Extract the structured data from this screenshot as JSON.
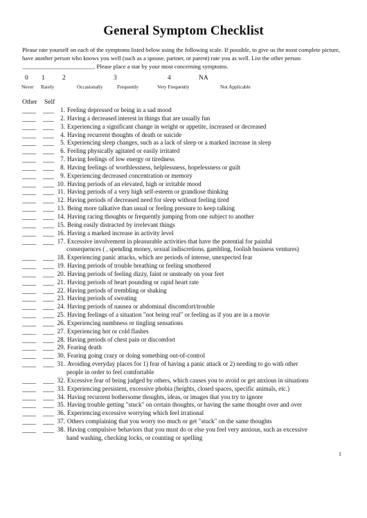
{
  "document": {
    "title": "General Symptom Checklist",
    "intro": "Please rate yourself on each of the symptoms listed below using the following scale. If possible, to give us the most complete picture, have another person who knows you well (such as a spouse, partner, or parent) rate you as well. List the other person ________________________. Please place a star by your most concerning symptoms.",
    "scale": [
      {
        "value": "0",
        "label": "Never"
      },
      {
        "value": "1",
        "label": "Rarely"
      },
      {
        "value": "2",
        "label": "Occasionally"
      },
      {
        "value": "3",
        "label": "Frequently"
      },
      {
        "value": "4",
        "label": "Very Frequently"
      },
      {
        "value": "NA",
        "label": "Not Applicable"
      }
    ],
    "columns": {
      "other": "Other",
      "self": "Self"
    },
    "items": [
      {
        "n": "1.",
        "text": "Feeling depressed or being in a sad mood"
      },
      {
        "n": "2.",
        "text": "Having a decreased interest in things that are usually fun"
      },
      {
        "n": "3.",
        "text": "Experiencing a significant change in weight or appetite, increased or decreased"
      },
      {
        "n": "4.",
        "text": "Having recurrent thoughts of death or suicide"
      },
      {
        "n": "5.",
        "text": "Experiencing sleep changes, such as a lack of sleep or a marked increase in sleep"
      },
      {
        "n": "6.",
        "text": "Feeling physically agitated or easily irritated"
      },
      {
        "n": "7.",
        "text": "Having feelings of low energy or tiredness"
      },
      {
        "n": "8.",
        "text": "Having feelings of worthlessness, helplessness, hopelessness or guilt"
      },
      {
        "n": "9.",
        "text": "Experiencing decreased concentration or memory"
      },
      {
        "n": "10.",
        "text": "Having periods of an elevated, high or irritable mood"
      },
      {
        "n": "11.",
        "text": "Having periods of a very high self-esteem or grandiose thinking"
      },
      {
        "n": "12.",
        "text": "Having periods of decreased need for sleep without feeling tired"
      },
      {
        "n": "13.",
        "text": "Being more talkative than usual or feeling pressure to keep talking"
      },
      {
        "n": "14.",
        "text": "Having racing thoughts or frequently jumping from one subject to another"
      },
      {
        "n": "15.",
        "text": "Being easily distracted by irrelevant things"
      },
      {
        "n": "16.",
        "text": "Having a marked increase in activity level"
      },
      {
        "n": "17.",
        "text": "Excessive involvement in pleasurable activities that have the potential for painful",
        "cont": "consequences ( , spending money, sexual indiscretions, gambling, foolish   business ventures)"
      },
      {
        "n": "18.",
        "text": "Experiencing panic attacks, which are periods of intense, unexpected fear"
      },
      {
        "n": "19.",
        "text": "Having periods of trouble breathing or feeling smothered"
      },
      {
        "n": "20.",
        "text": "Having periods of feeling dizzy, faint or unsteady on your feet"
      },
      {
        "n": "21.",
        "text": "Having periods of heart pounding or rapid heart rate"
      },
      {
        "n": "22.",
        "text": "Having periods of trembling or shaking"
      },
      {
        "n": "23.",
        "text": "Having periods of sweating"
      },
      {
        "n": "24.",
        "text": "Having periods of nausea or abdominal discomfort/trouble"
      },
      {
        "n": "25.",
        "text": "Having feelings of a situation \"not being real\" or feeling as if you are in a movie"
      },
      {
        "n": "26.",
        "text": "Experiencing numbness or tingling sensations"
      },
      {
        "n": "27.",
        "text": "Experiencing hot or cold flashes"
      },
      {
        "n": "28.",
        "text": "Having periods of chest pain or discomfort"
      },
      {
        "n": "29.",
        "text": "Fearing death"
      },
      {
        "n": "30.",
        "text": "Fearing going crazy or doing something out-of-control"
      },
      {
        "n": "31.",
        "text": "Avoiding everyday places for 1) fear of having a panic attack or 2) needing to go with other",
        "cont": "people in order to feel comfortable"
      },
      {
        "n": "32.",
        "text": "Excessive fear of being judged by others, which causes you to avoid or get anxious in situations"
      },
      {
        "n": "33.",
        "text": "Experiencing persistent, excessive phobia (heights, closed spaces, specific animals, etc.)"
      },
      {
        "n": "34.",
        "text": "Having recurrent bothersome thoughts, ideas, or images that you try to ignore"
      },
      {
        "n": "35.",
        "text": "Having trouble getting \"stuck\" on certain thoughts, or having the same thought over and over"
      },
      {
        "n": "36.",
        "text": "Experiencing excessive worrying which feel irrational"
      },
      {
        "n": "37.",
        "text": "Others complaining that you worry too much or get \"stuck\" on the same thoughts"
      },
      {
        "n": "38.",
        "text": "Having compulsive behaviors that you must do or else you feel very anxious, such as excessive",
        "cont": "hand washing, checking locks, or counting or spelling"
      }
    ],
    "page_number": "1"
  }
}
